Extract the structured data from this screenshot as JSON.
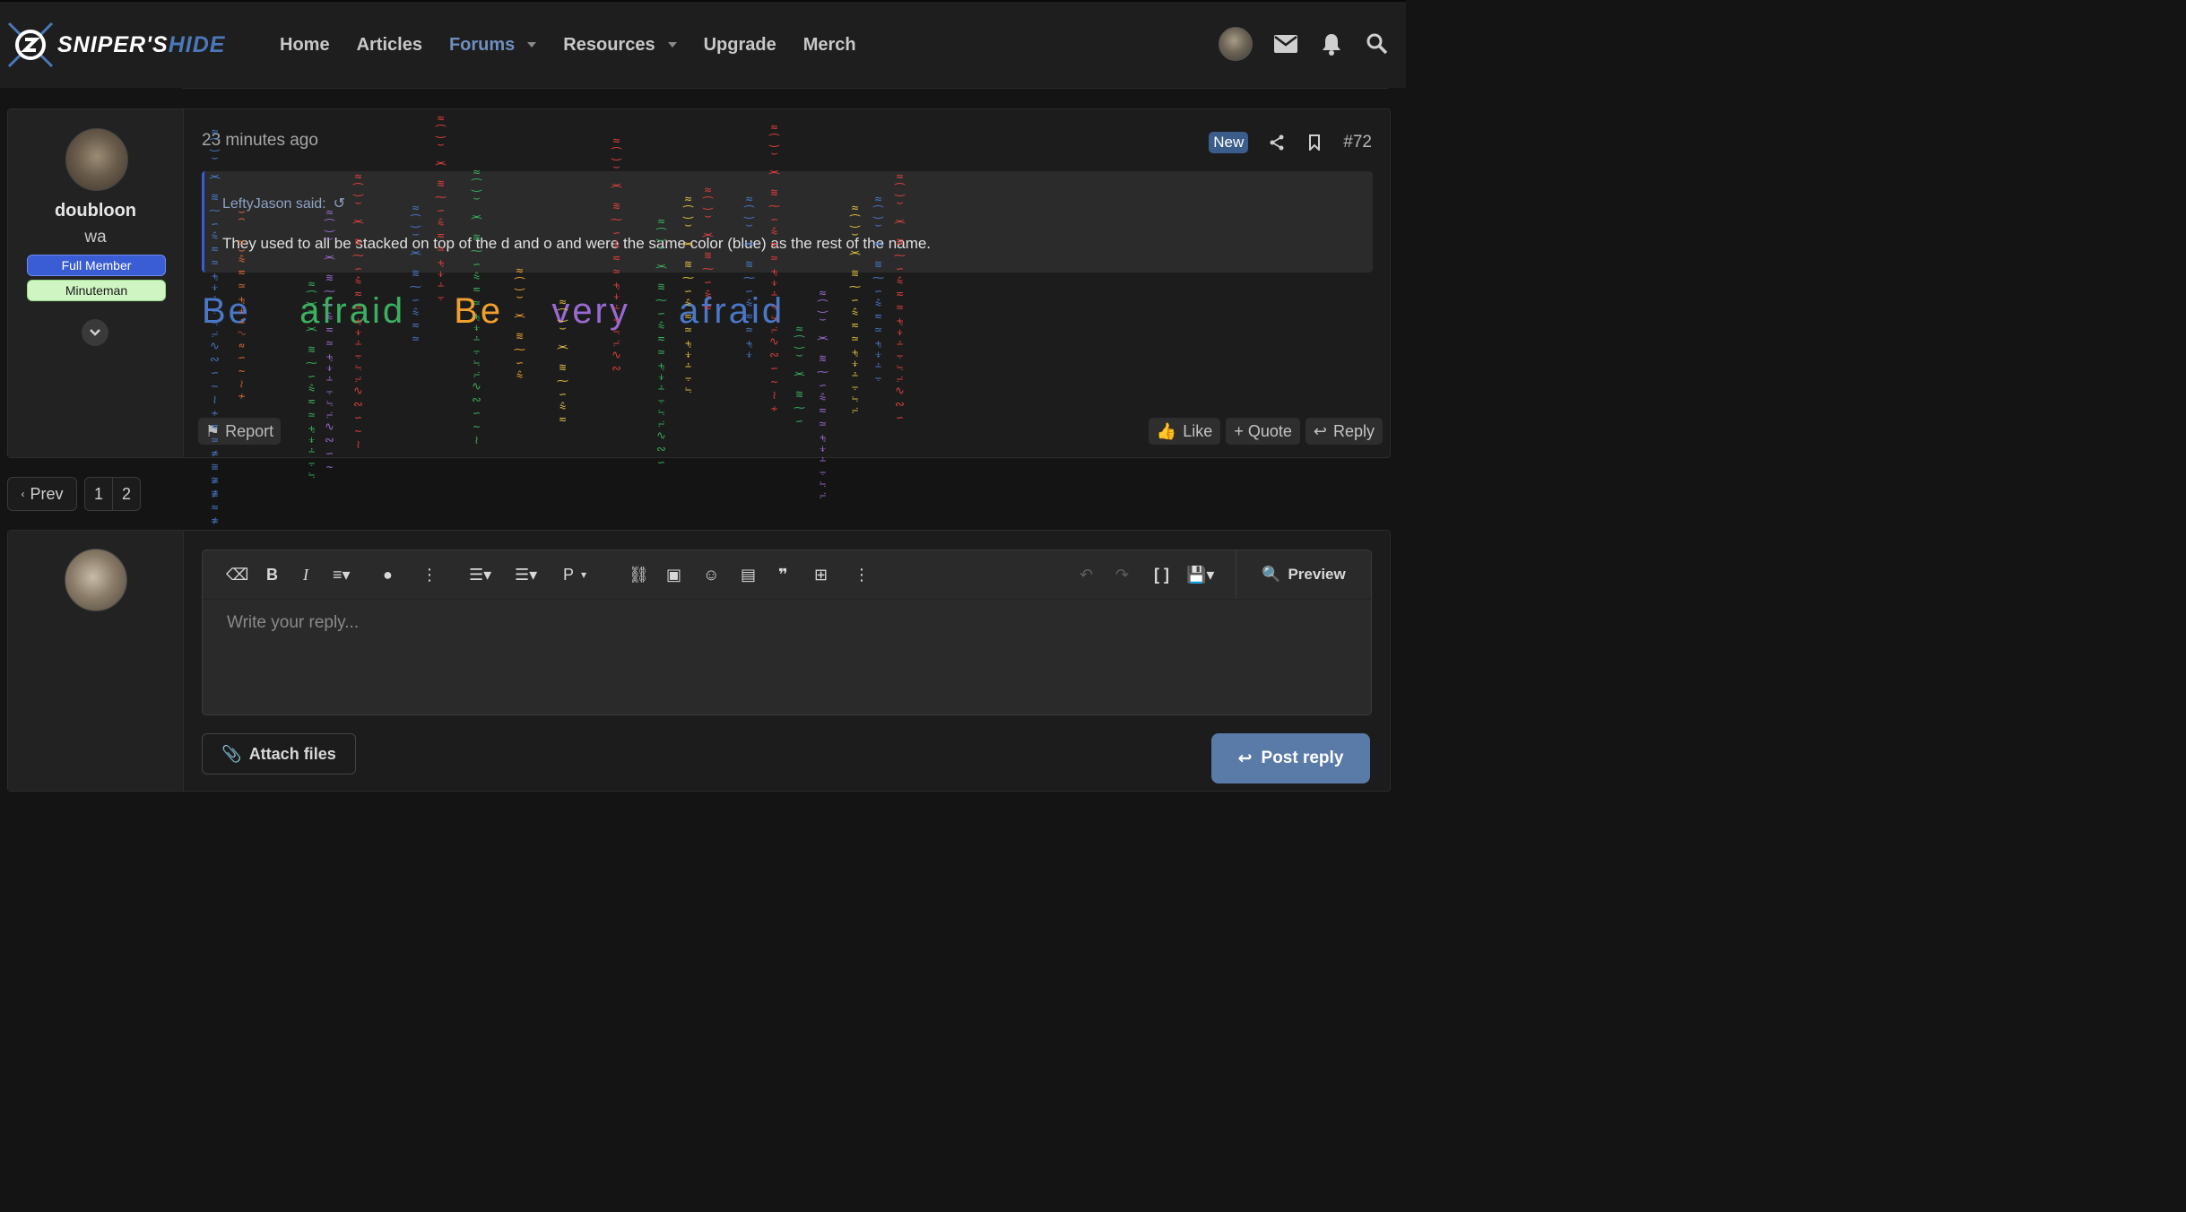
{
  "brand": {
    "part1": "SNIPER'S",
    "part2": "HIDE"
  },
  "nav": {
    "home": "Home",
    "articles": "Articles",
    "forums": "Forums",
    "resources": "Resources",
    "upgrade": "Upgrade",
    "merch": "Merch"
  },
  "post": {
    "time": "23 minutes ago",
    "new_badge": "New",
    "number": "#72",
    "user": {
      "name": "doubloon",
      "sub": "wa",
      "badge1": "Full Member",
      "badge2": "Minuteman"
    },
    "quote": {
      "author": "LeftyJason said:",
      "text": "They used to all be stacked on top of the d and o and were the same color (blue) as the rest of the name."
    },
    "zalgo_words": [
      "Be",
      "afraid",
      "Be",
      "very",
      "afraid"
    ],
    "report": "Report",
    "like": "Like",
    "quote_btn": "+ Quote",
    "reply": "Reply"
  },
  "pager": {
    "prev": "Prev",
    "pages": [
      "1",
      "2"
    ]
  },
  "reply_box": {
    "placeholder": "Write your reply...",
    "preview": "Preview",
    "attach": "Attach files",
    "post_reply": "Post reply",
    "paragraph_label": "P"
  },
  "colors": {
    "accent": "#3a5cd4",
    "brand_blue": "#4a78b8",
    "post_reply_bg": "#5a7aa8",
    "minuteman_bg": "#cff5c2"
  }
}
